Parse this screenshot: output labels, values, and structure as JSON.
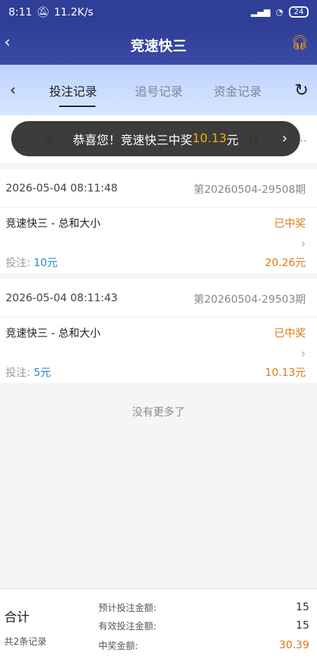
{
  "status_bar": {
    "time": "8:11",
    "speed": "11.2K/s",
    "battery": "24"
  },
  "app_bar": {
    "title": "竞速快三"
  },
  "tabs": [
    {
      "label": "投注记录",
      "active": true
    },
    {
      "label": "追号记录",
      "active": false
    },
    {
      "label": "资金记录",
      "active": false
    }
  ],
  "filters": {
    "left": "今",
    "right": "种"
  },
  "toast": {
    "prefix": "恭喜您！竞速快三中奖",
    "amount": "10.13",
    "suffix": "元"
  },
  "records": [
    {
      "time": "2026-05-04 08:11:48",
      "period": "第20260504-29508期",
      "game": "竞速快三 - 总和大小",
      "status": "已中奖",
      "bet_label": "投注:",
      "bet_value": "10元",
      "win": "20.26元"
    },
    {
      "time": "2026-05-04 08:11:43",
      "period": "第20260504-29503期",
      "game": "竞速快三 - 总和大小",
      "status": "已中奖",
      "bet_label": "投注:",
      "bet_value": "5元",
      "win": "10.13元"
    }
  ],
  "no_more": "没有更多了",
  "footer": {
    "total_label": "合计",
    "count": "共2条记录",
    "rows": [
      {
        "label": "预计投注金额:",
        "value": "15"
      },
      {
        "label": "有效投注金额:",
        "value": "15"
      },
      {
        "label": "中奖金额:",
        "value": "30.39"
      }
    ]
  },
  "colors": {
    "header": "#2f3f98",
    "accent": "#e07a17",
    "bet_blue": "#2a85c7"
  }
}
